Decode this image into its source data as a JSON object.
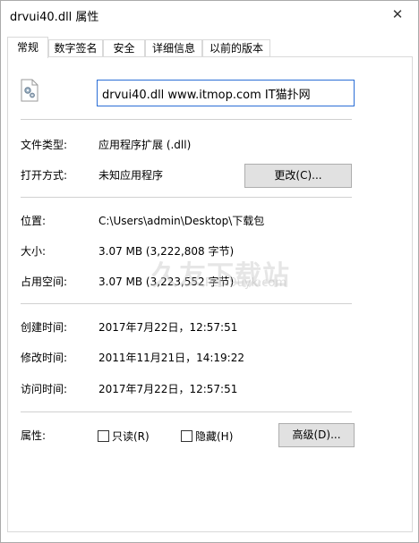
{
  "window": {
    "title": "drvui40.dll 属性",
    "close_glyph": "✕"
  },
  "tabs": [
    {
      "label": "常规",
      "active": true
    },
    {
      "label": "数字签名",
      "active": false
    },
    {
      "label": "安全",
      "active": false
    },
    {
      "label": "详细信息",
      "active": false
    },
    {
      "label": "以前的版本",
      "active": false
    }
  ],
  "file": {
    "icon": "dll-file-gear-icon",
    "name": "drvui40.dll www.itmop.com IT猫扑网"
  },
  "general": {
    "type_label": "文件类型:",
    "type_value": "应用程序扩展 (.dll)",
    "open_with_label": "打开方式:",
    "open_with_value": "未知应用程序",
    "change_button": "更改(C)..."
  },
  "location": {
    "location_label": "位置:",
    "location_value": "C:\\Users\\admin\\Desktop\\下载包",
    "size_label": "大小:",
    "size_value": "3.07 MB (3,222,808 字节)",
    "size_on_disk_label": "占用空间:",
    "size_on_disk_value": "3.07 MB (3,223,552 字节)"
  },
  "times": {
    "created_label": "创建时间:",
    "created_value": "2017年7月22日，12:57:51",
    "modified_label": "修改时间:",
    "modified_value": "2011年11月21日，14:19:22",
    "accessed_label": "访问时间:",
    "accessed_value": "2017年7月22日，12:57:51"
  },
  "attributes": {
    "label": "属性:",
    "readonly_label": "只读(R)",
    "readonly_checked": false,
    "hidden_label": "隐藏(H)",
    "hidden_checked": false,
    "advanced_button": "高级(D)..."
  },
  "watermark": {
    "text": "久友下载站",
    "subtext": "Pc6.9uyk.com"
  }
}
